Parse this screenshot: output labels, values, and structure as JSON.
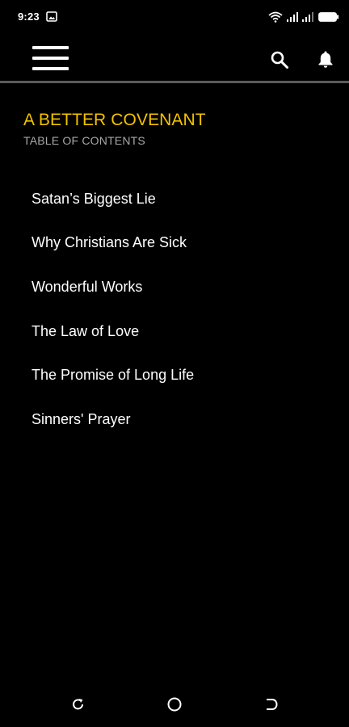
{
  "status_bar": {
    "time": "9:23",
    "icons": [
      "gallery-icon",
      "wifi-icon",
      "signal-icon",
      "signal-icon",
      "battery-icon"
    ]
  },
  "app_bar": {
    "icons": [
      "menu-icon",
      "search-icon",
      "bell-icon"
    ]
  },
  "header": {
    "title": "A BETTER COVENANT",
    "subtitle": "TABLE OF CONTENTS"
  },
  "toc": {
    "items": [
      {
        "label": "Satan’s Biggest Lie"
      },
      {
        "label": "Why Christians Are Sick"
      },
      {
        "label": "Wonderful Works"
      },
      {
        "label": "The Law of Love"
      },
      {
        "label": "The Promise of Long Life"
      },
      {
        "label": "Sinners' Prayer"
      }
    ]
  },
  "nav_bar": {
    "icons": [
      "recents-icon",
      "home-icon",
      "back-icon"
    ]
  },
  "colors": {
    "background": "#000000",
    "accent": "#f2c200",
    "subtitle": "#a8a8a8",
    "text": "#ffffff",
    "divider": "#5a5a5a"
  }
}
